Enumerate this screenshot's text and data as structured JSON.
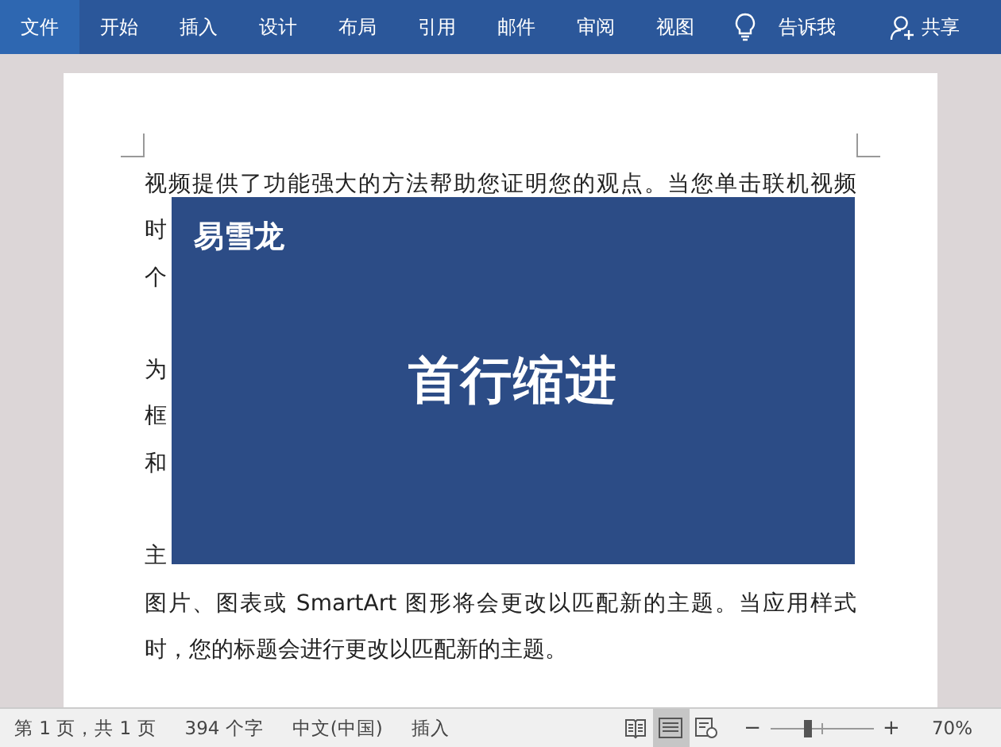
{
  "ribbon": {
    "tabs": [
      {
        "label": "文件",
        "selected": true
      },
      {
        "label": "开始",
        "selected": false
      },
      {
        "label": "插入",
        "selected": false
      },
      {
        "label": "设计",
        "selected": false
      },
      {
        "label": "布局",
        "selected": false
      },
      {
        "label": "引用",
        "selected": false
      },
      {
        "label": "邮件",
        "selected": false
      },
      {
        "label": "审阅",
        "selected": false
      },
      {
        "label": "视图",
        "selected": false
      }
    ],
    "tell_me": "告诉我",
    "share": "共享"
  },
  "document": {
    "lines": [
      {
        "text": "视频提供了功能强大的方法帮助您证明您的观点。当您单击联机视频",
        "kind": "full"
      },
      {
        "text": "时",
        "kind": "cut"
      },
      {
        "text": "个",
        "kind": "cut"
      },
      {
        "kind": "blank"
      },
      {
        "text": "为",
        "kind": "cut"
      },
      {
        "text": "框",
        "kind": "cut"
      },
      {
        "text": "和",
        "kind": "cut"
      },
      {
        "kind": "blank"
      },
      {
        "text": "主",
        "kind": "cut"
      },
      {
        "text": "图片、图表或 SmartArt 图形将会更改以匹配新的主题。当应用样式",
        "kind": "full"
      },
      {
        "text": "时，您的标题会进行更改以匹配新的主题。",
        "kind": "last"
      }
    ]
  },
  "overlay": {
    "brand": "易雪龙",
    "title": "首行缩进"
  },
  "status_bar": {
    "page": "第 1 页，共 1 页",
    "words": "394 个字",
    "language": "中文(中国)",
    "mode": "插入",
    "views": [
      {
        "kind": "read",
        "selected": false
      },
      {
        "kind": "print",
        "selected": true
      },
      {
        "kind": "web",
        "selected": false
      }
    ],
    "zoom": {
      "minus": "−",
      "plus": "+",
      "level": 0.35,
      "reading": "70%"
    }
  }
}
